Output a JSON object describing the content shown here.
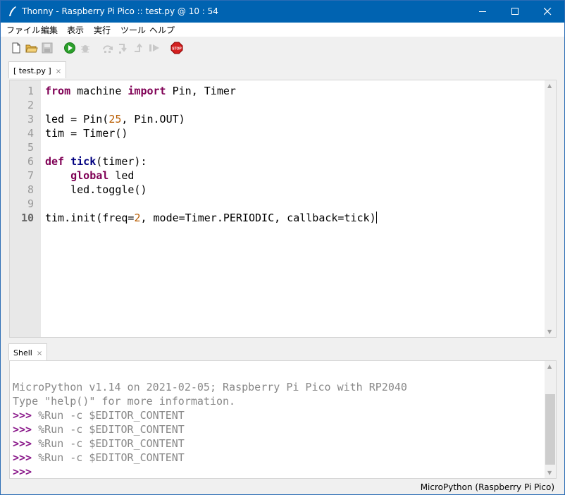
{
  "window": {
    "title": "Thonny  -  Raspberry Pi Pico :: test.py  @  10 : 54",
    "controls": [
      "minimize-icon",
      "maximize-icon",
      "close-icon"
    ]
  },
  "menu": [
    "ファイル",
    "編集",
    "表示",
    "実行",
    "ツール",
    "ヘルプ"
  ],
  "toolbar": {
    "icons": [
      "new-file-icon",
      "open-file-icon",
      "save-icon",
      "run-icon",
      "debug-icon",
      "step-over-icon",
      "step-into-icon",
      "step-out-icon",
      "resume-icon",
      "stop-icon"
    ],
    "stop_label": "STOP"
  },
  "editor": {
    "tab_label": "[ test.py ]",
    "tab_close": "×",
    "line_numbers": [
      "1",
      "2",
      "3",
      "4",
      "5",
      "6",
      "7",
      "8",
      "9",
      "10"
    ],
    "current_line": 10,
    "tokens": {
      "from": "from",
      "machine": " machine ",
      "import": "import",
      "pin_timer": " Pin, Timer",
      "led_pin": "led = Pin(",
      "n25": "25",
      "pin_out": ", Pin.OUT)",
      "tim_timer": "tim = Timer()",
      "def": "def",
      "sp": " ",
      "tick": "tick",
      "timer_arg": "(timer):",
      "indent": "    ",
      "global": "global",
      "led": " led",
      "toggle": "    led.toggle()",
      "init_a": "tim.init(freq=",
      "n2": "2",
      "init_b": ", mode=Timer.PERIODIC, callback=tick)"
    }
  },
  "shell": {
    "tab_label": "Shell",
    "tab_close": "×",
    "lines": [
      {
        "prompt": "",
        "text": "MicroPython v1.14 on 2021-02-05; Raspberry Pi Pico with RP2040"
      },
      {
        "prompt": "",
        "text": "Type \"help()\" for more information."
      },
      {
        "prompt": ">>> ",
        "text": "%Run -c $EDITOR_CONTENT"
      },
      {
        "prompt": ">>> ",
        "text": "%Run -c $EDITOR_CONTENT"
      },
      {
        "prompt": ">>> ",
        "text": "%Run -c $EDITOR_CONTENT"
      },
      {
        "prompt": ">>> ",
        "text": "%Run -c $EDITOR_CONTENT"
      },
      {
        "prompt": ">>> ",
        "text": ""
      }
    ]
  },
  "status": {
    "interpreter": "MicroPython (Raspberry Pi Pico)"
  }
}
